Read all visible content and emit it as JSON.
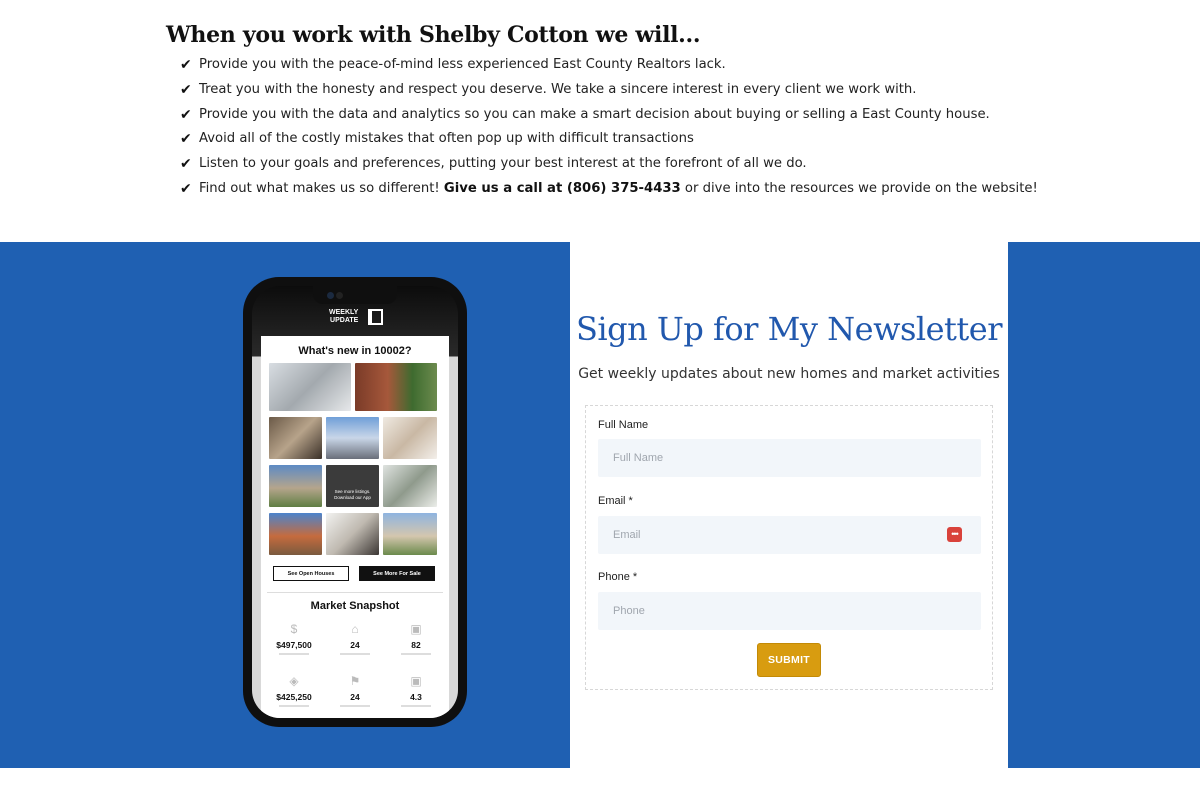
{
  "benefits": {
    "heading": "When you work with Shelby Cotton we will...",
    "check_icon": "check-icon",
    "items": [
      {
        "text": "Provide you with the peace-of-mind less experienced East County Realtors lack."
      },
      {
        "text": "Treat you with the honesty and respect you deserve. We take a sincere interest in every client we work with."
      },
      {
        "text": "Provide you with the data and analytics so you can make a smart decision about buying or selling a East County house."
      },
      {
        "text": "Avoid all of the costly mistakes that often pop up with difficult transactions"
      },
      {
        "text": "Listen to your goals and preferences, putting your best interest at the forefront of all we do."
      }
    ],
    "last_item": {
      "prefix": "Find out what makes us so different! ",
      "bold": "Give us a call at (806) 375-4433",
      "suffix": " or dive into the resources we provide on the website!"
    }
  },
  "newsletter": {
    "title": "Sign Up for My Newsletter",
    "subtitle": "Get weekly updates about new homes and market activities",
    "fields": {
      "full_name": {
        "label": "Full Name",
        "placeholder": "Full Name"
      },
      "email": {
        "label": "Email *",
        "placeholder": "Email"
      },
      "phone": {
        "label": "Phone *",
        "placeholder": "Phone"
      }
    },
    "submit_label": "SUBMIT",
    "colors": {
      "band": "#1f60b2",
      "title": "#2158ad",
      "submit": "#d89c10"
    }
  },
  "phone_mockup": {
    "logo_line1": "WEEKLY",
    "logo_line2": "UPDATE",
    "headline": "What's new in 10002?",
    "app_tile_text": "See more listings. Download our App",
    "button_open_houses": "See Open Houses",
    "button_more_for_sale": "See More For Sale",
    "snapshot_title": "Market Snapshot",
    "stats": [
      {
        "icon": "dollar-icon",
        "value": "$497,500"
      },
      {
        "icon": "house-icon",
        "value": "24"
      },
      {
        "icon": "calendar-icon",
        "value": "82"
      },
      {
        "icon": "tag-icon",
        "value": "$425,250"
      },
      {
        "icon": "flag-icon",
        "value": "24"
      },
      {
        "icon": "calendar-icon",
        "value": "4.3"
      }
    ]
  }
}
